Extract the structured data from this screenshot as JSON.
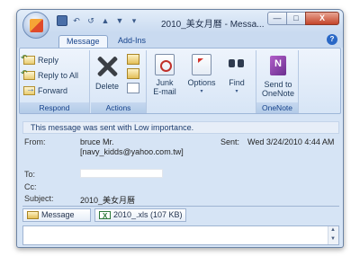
{
  "window": {
    "title": "2010_美女月曆 - Messa...",
    "min_label": "—",
    "max_label": "□",
    "close_label": "X"
  },
  "qat": {
    "undo": "↶",
    "redo": "↺",
    "up": "▲",
    "down": "▼",
    "more": "▾"
  },
  "tabs": [
    {
      "label": "Message",
      "active": true
    },
    {
      "label": "Add-Ins",
      "active": false
    }
  ],
  "help_label": "?",
  "ribbon": {
    "respond": {
      "label": "Respond",
      "reply": "Reply",
      "reply_all": "Reply to All",
      "forward": "Forward"
    },
    "actions": {
      "label": "Actions",
      "delete": "Delete"
    },
    "junk": {
      "line1": "Junk",
      "line2": "E-mail"
    },
    "options": {
      "label": "Options"
    },
    "find": {
      "label": "Find"
    },
    "onenote": {
      "label": "OneNote",
      "line1": "Send to",
      "line2": "OneNote"
    },
    "caret": "▾"
  },
  "infobar": {
    "text": "This message was sent with Low importance."
  },
  "message": {
    "from_label": "From:",
    "from_name": "bruce Mr.",
    "from_email": "[navy_kidds@yahoo.com.tw]",
    "sent_label": "Sent:",
    "sent_value": "Wed 3/24/2010 4:44 AM",
    "to_label": "To:",
    "cc_label": "Cc:",
    "subject_label": "Subject:",
    "subject_value": "2010_美女月曆"
  },
  "attachments": [
    {
      "label": "Message",
      "icon": "mail-icon"
    },
    {
      "label": "2010_.xls (107 KB)",
      "icon": "excel-icon"
    }
  ],
  "scroll": {
    "up": "▲",
    "down": "▼"
  }
}
